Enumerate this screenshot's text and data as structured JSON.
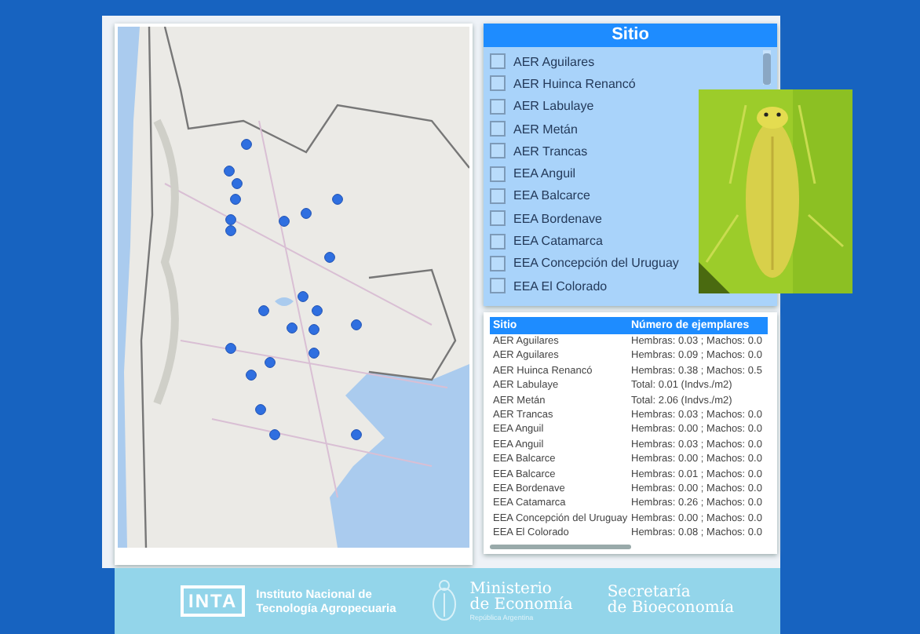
{
  "slicer": {
    "title": "Sitio",
    "items": [
      {
        "label": "AER Aguilares",
        "checked": false
      },
      {
        "label": "AER Huinca Renancó",
        "checked": false
      },
      {
        "label": "AER Labulaye",
        "checked": false
      },
      {
        "label": "AER Metán",
        "checked": false
      },
      {
        "label": "AER Trancas",
        "checked": false
      },
      {
        "label": "EEA Anguil",
        "checked": false
      },
      {
        "label": "EEA Balcarce",
        "checked": false
      },
      {
        "label": "EEA Bordenave",
        "checked": false
      },
      {
        "label": "EEA Catamarca",
        "checked": false
      },
      {
        "label": "EEA Concepción del Uruguay",
        "checked": false
      },
      {
        "label": "EEA El Colorado",
        "checked": false
      }
    ]
  },
  "table": {
    "columns": [
      "Sitio",
      "Número de ejemplares"
    ],
    "rows": [
      [
        "AER Aguilares",
        "Hembras: 0.03 ; Machos: 0.0"
      ],
      [
        "AER Aguilares",
        "Hembras: 0.09 ; Machos: 0.0"
      ],
      [
        "AER Huinca Renancó",
        "Hembras: 0.38 ; Machos: 0.5"
      ],
      [
        "AER Labulaye",
        "Total: 0.01 (Indvs./m2)"
      ],
      [
        "AER Metán",
        "Total: 2.06 (Indvs./m2)"
      ],
      [
        "AER Trancas",
        "Hembras: 0.03 ; Machos: 0.0"
      ],
      [
        "EEA Anguil",
        "Hembras: 0.00 ; Machos: 0.0"
      ],
      [
        "EEA Anguil",
        "Hembras: 0.03 ; Machos: 0.0"
      ],
      [
        "EEA Balcarce",
        "Hembras: 0.00 ; Machos: 0.0"
      ],
      [
        "EEA Balcarce",
        "Hembras: 0.01 ; Machos: 0.0"
      ],
      [
        "EEA Bordenave",
        "Hembras: 0.00 ; Machos: 0.0"
      ],
      [
        "EEA Catamarca",
        "Hembras: 0.26 ; Machos: 0.0"
      ],
      [
        "EEA Concepción del Uruguay",
        "Hembras: 0.00 ; Machos: 0.0"
      ],
      [
        "EEA El Colorado",
        "Hembras: 0.08 ; Machos: 0.0"
      ]
    ]
  },
  "footer": {
    "inta": {
      "mark": "INTA",
      "name": [
        "Instituto Nacional de",
        "Tecnología Agropecuaria"
      ]
    },
    "ministerio": {
      "name": [
        "Ministerio",
        "de Economía"
      ],
      "sub": "República Argentina"
    },
    "secretaria": {
      "name": [
        "Secretaría",
        "de Bioeconomía"
      ]
    }
  }
}
